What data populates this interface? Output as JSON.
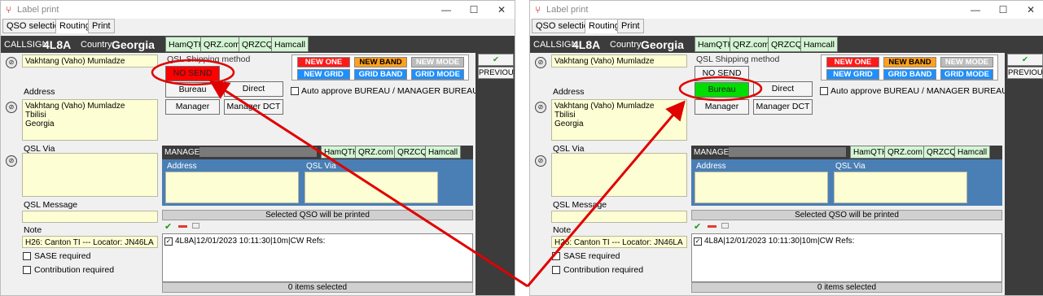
{
  "window": {
    "title": "Label print",
    "tabs": [
      "QSO selection",
      "Routing",
      "Print"
    ],
    "minimize": "—",
    "maximize": "☐",
    "close": "✕"
  },
  "callsign_bar": {
    "callsign_label": "CALLSIGN",
    "callsign": "4L8A",
    "country_label": "Country",
    "country": "Georgia",
    "links": [
      "HamQTH",
      "QRZ.com",
      "QRZCQ",
      "Hamcall"
    ]
  },
  "name": "Vakhtang (Vaho) Mumladze",
  "address_label": "Address",
  "address_lines": [
    "Vakhtang (Vaho) Mumladze",
    "Tbilisi",
    "Georgia"
  ],
  "qsl_via_label": "QSL Via",
  "qsl_message_label": "QSL Message",
  "note_label": "Note",
  "note": "H26: Canton TI --- Locator: JN46LA",
  "sase_label": "SASE required",
  "contribution_label": "Contribution required",
  "shipping": {
    "group_label": "QSL Shipping method",
    "no_send": "NO SEND",
    "bureau": "Bureau",
    "direct": "Direct",
    "manager": "Manager",
    "manager_dct": "Manager DCT"
  },
  "modes": {
    "new_one": "NEW ONE",
    "new_band": "NEW BAND",
    "new_mode": "NEW MODE",
    "new_grid": "NEW GRID",
    "grid_band": "GRID BAND",
    "grid_mode": "GRID MODE"
  },
  "auto_approve_label": "Auto approve BUREAU / MANAGER BUREAU",
  "manager_panel": {
    "label": "MANAGER",
    "links": [
      "HamQTH",
      "QRZ.com",
      "QRZCQ",
      "Hamcall"
    ],
    "address_label": "Address",
    "qsl_via_label": "QSL Via"
  },
  "selected_msg": "Selected QSO will be printed",
  "qso_item": "4L8A|12/01/2023 10:11:30|10m|CW Refs:",
  "items_selected": "0 items selected",
  "previous": "PREVIOUS",
  "colors": {
    "no_send_active": "#ff0000",
    "bureau_active": "#00dd00",
    "annotation": "#e00000"
  }
}
